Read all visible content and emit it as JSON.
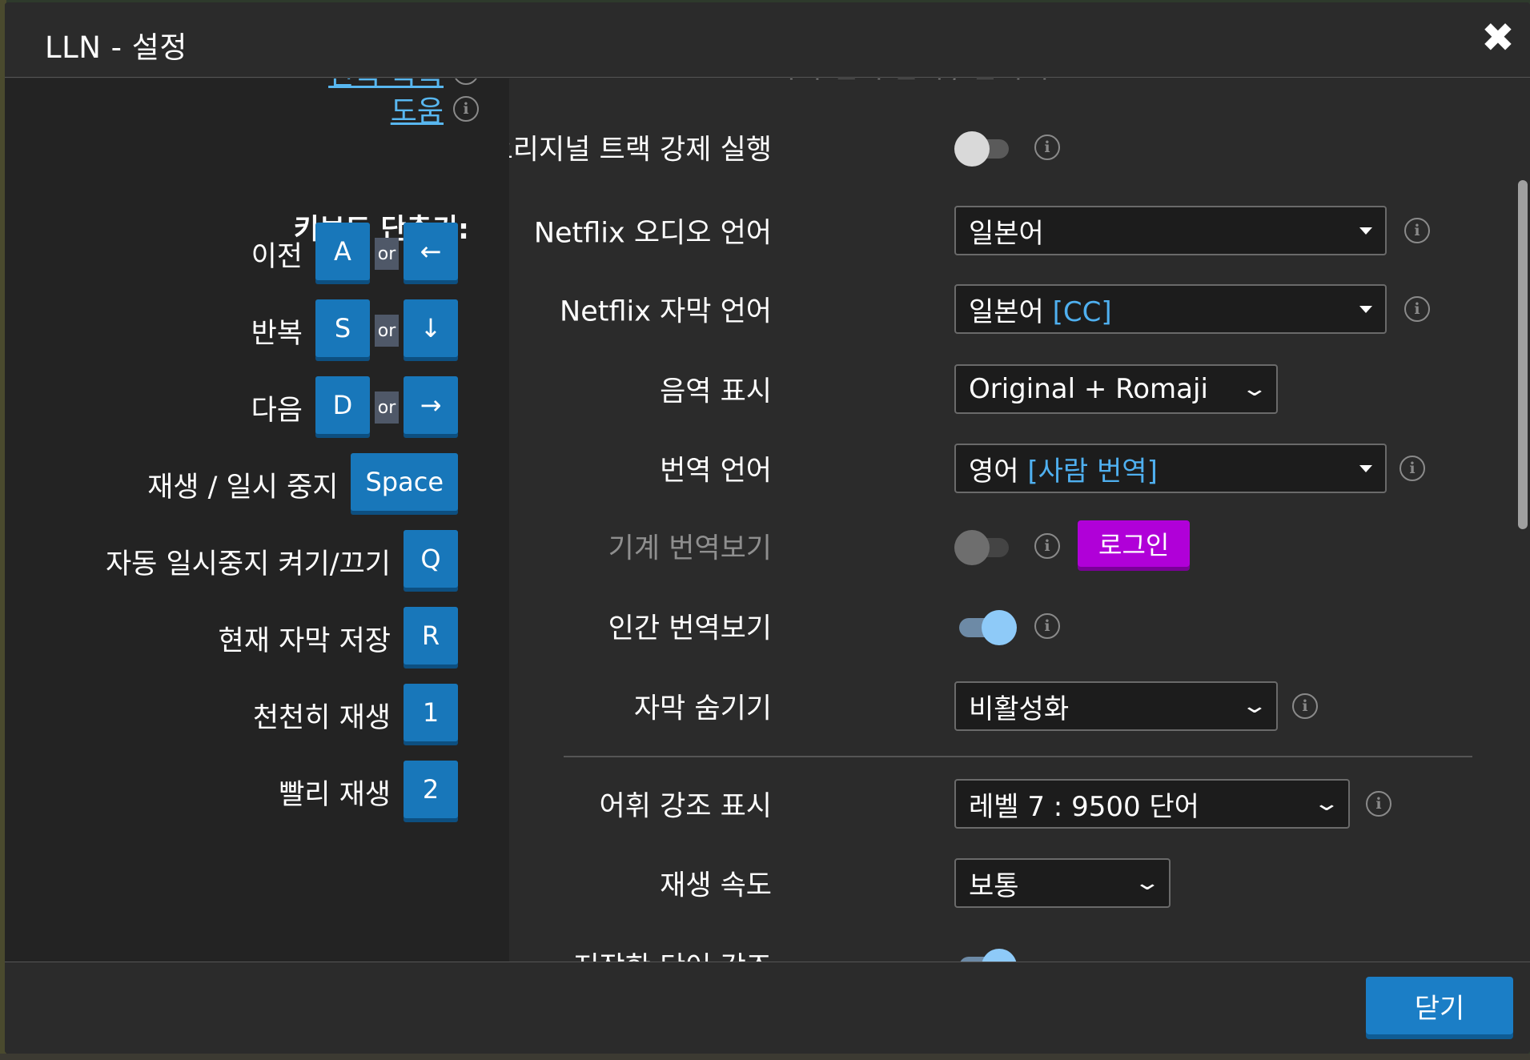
{
  "window": {
    "title": "LLN - 설정",
    "close_glyph": "✖"
  },
  "left": {
    "links": [
      {
        "label": "단축 목록"
      },
      {
        "label": "도움"
      }
    ],
    "shortcuts_heading": "키보드 단축키:",
    "or_text": "or",
    "shortcuts": [
      {
        "label": "이전",
        "keys": [
          "A",
          "←"
        ]
      },
      {
        "label": "반복",
        "keys": [
          "S",
          "↓"
        ]
      },
      {
        "label": "다음",
        "keys": [
          "D",
          "→"
        ]
      },
      {
        "label": "재생 / 일시 중지",
        "keys": [
          "Space"
        ]
      },
      {
        "label": "자동 일시중지 켜기/끄기",
        "keys": [
          "Q"
        ]
      },
      {
        "label": "현재 자막 저장",
        "keys": [
          "R"
        ]
      },
      {
        "label": "천천히 재생",
        "keys": [
          "1"
        ]
      },
      {
        "label": "빨리 재생",
        "keys": [
          "2"
        ]
      }
    ]
  },
  "right": {
    "partial_top_label": "자막 번역 단어 / 단어 수",
    "settings": {
      "force_original": {
        "label": "오리지널 트랙 강제 실행",
        "state": "off"
      },
      "audio_language": {
        "label": "Netflix 오디오 언어",
        "value": "일본어"
      },
      "subtitle_language": {
        "label": "Netflix 자막 언어",
        "value": "일본어",
        "tag": "[CC]"
      },
      "transliteration": {
        "label": "음역 표시",
        "value": "Original + Romaji"
      },
      "translation_language": {
        "label": "번역 언어",
        "value": "영어",
        "tag": "[사람 번역]"
      },
      "machine_translation": {
        "label": "기계 번역보기",
        "state": "off",
        "disabled": true,
        "login_label": "로그인"
      },
      "human_translation": {
        "label": "인간 번역보기",
        "state": "on"
      },
      "hide_subtitles": {
        "label": "자막 숨기기",
        "value": "비활성화"
      },
      "vocab_highlight": {
        "label": "어휘 강조 표시",
        "value": "레벨 7 : 9500 단어"
      },
      "playback_speed": {
        "label": "재생 속도",
        "value": "보통"
      },
      "saved_word_highlight": {
        "label": "저장한 단어 강조",
        "state": "on"
      }
    }
  },
  "footer": {
    "close_label": "닫기"
  },
  "colors": {
    "accent_blue": "#1b7ec6",
    "key_blue": "#1877ba",
    "link_blue": "#58b7f0",
    "login_purple": "#b000d8",
    "toggle_on": "#8ecaf8",
    "panel_dark": "#232323",
    "panel": "#2b2b2b"
  }
}
